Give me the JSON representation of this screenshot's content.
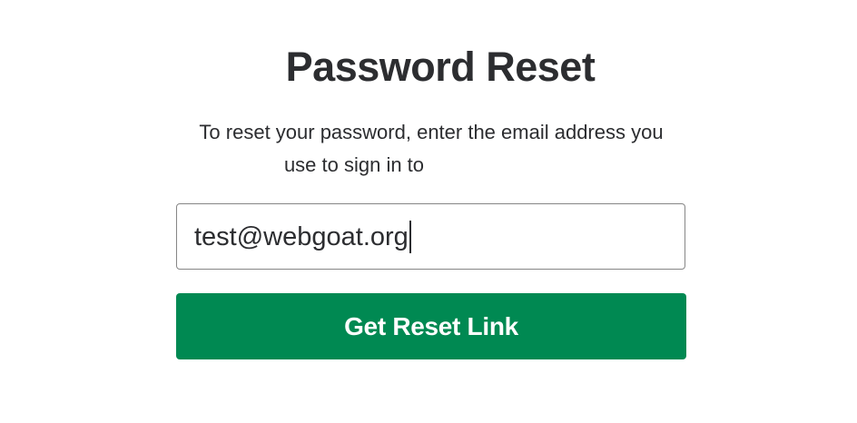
{
  "form": {
    "title": "Password Reset",
    "instructions_line1": "To reset your password, enter the email address you",
    "instructions_line2": "use to sign in to",
    "email_value": "test@webgoat.org",
    "submit_label": "Get Reset Link"
  },
  "colors": {
    "button_background": "#008952",
    "button_text": "#ffffff",
    "text": "#2c2d30",
    "input_border": "#868686"
  }
}
